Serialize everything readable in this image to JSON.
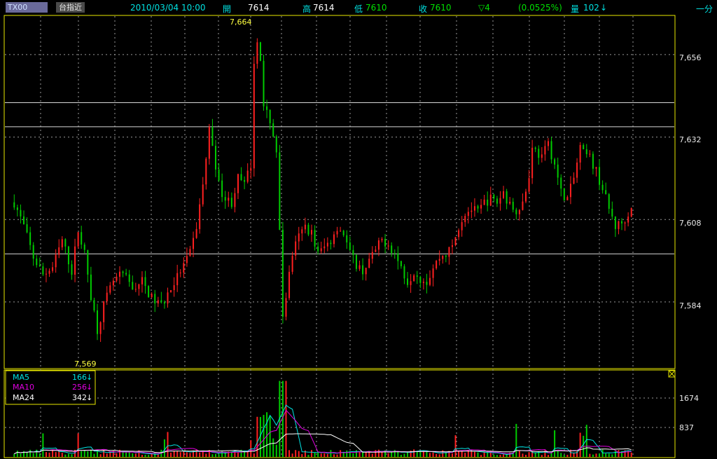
{
  "header": {
    "symbol": "TX00",
    "symbol_name": "台指近",
    "datetime": "2010/03/04 10:00",
    "open_label": "開",
    "open_value": "7614",
    "high_label": "高",
    "high_value": "7614",
    "low_label": "低",
    "low_value": "7610",
    "close_label": "收",
    "close_value": "7610",
    "change": "▽4",
    "change_pct": "(0.0525%)",
    "volume_label": "量",
    "volume_value": "102",
    "volume_arrow": "↓",
    "period": "一分"
  },
  "price_axis": {
    "ticks": [
      "7,656",
      "7,632",
      "7,608",
      "7,584"
    ]
  },
  "annotations": {
    "high_marker": "7,664",
    "low_marker": "7,569"
  },
  "volume_panel": {
    "legend": [
      {
        "label": "MA5",
        "value": "166",
        "arrow": "↓",
        "color": "#00e5e5"
      },
      {
        "label": "MA10",
        "value": "256",
        "arrow": "↓",
        "color": "#e000e0"
      },
      {
        "label": "MA24",
        "value": "342",
        "arrow": "↓",
        "color": "#ffffff"
      }
    ],
    "ticks": [
      "1674",
      "837"
    ],
    "close_icon": "close-box-icon"
  },
  "colors": {
    "up": "#ff2020",
    "down": "#00cc00",
    "frame": "#e8e800",
    "grid": "#9a9a9a",
    "header_text": "#00e0e0",
    "yellow_text": "#ffff40",
    "green_text": "#00e000"
  },
  "chart_data": {
    "type": "candlestick",
    "ylim": [
      7565,
      7667
    ],
    "high": 7664,
    "low": 7569,
    "horizontal_lines": [
      7642,
      7635,
      7598
    ],
    "price_path": [
      [
        0,
        7613
      ],
      [
        3,
        7606
      ],
      [
        6,
        7597
      ],
      [
        9,
        7592
      ],
      [
        12,
        7594
      ],
      [
        15,
        7602
      ],
      [
        18,
        7593
      ],
      [
        20,
        7605
      ],
      [
        22,
        7598
      ],
      [
        24,
        7586
      ],
      [
        26,
        7576
      ],
      [
        28,
        7583
      ],
      [
        31,
        7590
      ],
      [
        34,
        7592
      ],
      [
        37,
        7588
      ],
      [
        40,
        7590
      ],
      [
        43,
        7585
      ],
      [
        46,
        7583
      ],
      [
        49,
        7588
      ],
      [
        52,
        7593
      ],
      [
        55,
        7598
      ],
      [
        57,
        7606
      ],
      [
        59,
        7618
      ],
      [
        61,
        7634
      ],
      [
        62,
        7630
      ],
      [
        64,
        7618
      ],
      [
        66,
        7614
      ],
      [
        68,
        7613
      ],
      [
        70,
        7620
      ],
      [
        72,
        7618
      ],
      [
        74,
        7624
      ],
      [
        75,
        7652
      ],
      [
        76,
        7661
      ],
      [
        77,
        7655
      ],
      [
        78,
        7640
      ],
      [
        80,
        7637
      ],
      [
        82,
        7628
      ],
      [
        84,
        7580
      ],
      [
        85,
        7586
      ],
      [
        87,
        7598
      ],
      [
        89,
        7603
      ],
      [
        91,
        7606
      ],
      [
        93,
        7604
      ],
      [
        95,
        7598
      ],
      [
        97,
        7600
      ],
      [
        99,
        7602
      ],
      [
        101,
        7606
      ],
      [
        103,
        7604
      ],
      [
        105,
        7598
      ],
      [
        107,
        7595
      ],
      [
        109,
        7593
      ],
      [
        111,
        7596
      ],
      [
        113,
        7599
      ],
      [
        115,
        7602
      ],
      [
        117,
        7601
      ],
      [
        119,
        7598
      ],
      [
        121,
        7594
      ],
      [
        123,
        7590
      ],
      [
        125,
        7593
      ],
      [
        127,
        7591
      ],
      [
        129,
        7590
      ],
      [
        131,
        7594
      ],
      [
        133,
        7597
      ],
      [
        135,
        7598
      ],
      [
        137,
        7600
      ],
      [
        139,
        7606
      ],
      [
        141,
        7610
      ],
      [
        143,
        7611
      ],
      [
        145,
        7610
      ],
      [
        147,
        7613
      ],
      [
        149,
        7614
      ],
      [
        151,
        7613
      ],
      [
        153,
        7616
      ],
      [
        155,
        7612
      ],
      [
        157,
        7611
      ],
      [
        159,
        7613
      ],
      [
        161,
        7620
      ],
      [
        162,
        7630
      ],
      [
        163,
        7628
      ],
      [
        165,
        7626
      ],
      [
        167,
        7630
      ],
      [
        169,
        7624
      ],
      [
        171,
        7616
      ],
      [
        173,
        7614
      ],
      [
        175,
        7620
      ],
      [
        177,
        7629
      ],
      [
        178,
        7627
      ],
      [
        180,
        7626
      ],
      [
        182,
        7622
      ],
      [
        184,
        7617
      ],
      [
        186,
        7611
      ],
      [
        188,
        7606
      ],
      [
        190,
        7607
      ],
      [
        192,
        7610
      ],
      [
        193,
        7612
      ]
    ],
    "volume_series": {
      "ma5": [
        166
      ],
      "ma10": [
        256
      ],
      "ma24": [
        342
      ]
    }
  }
}
